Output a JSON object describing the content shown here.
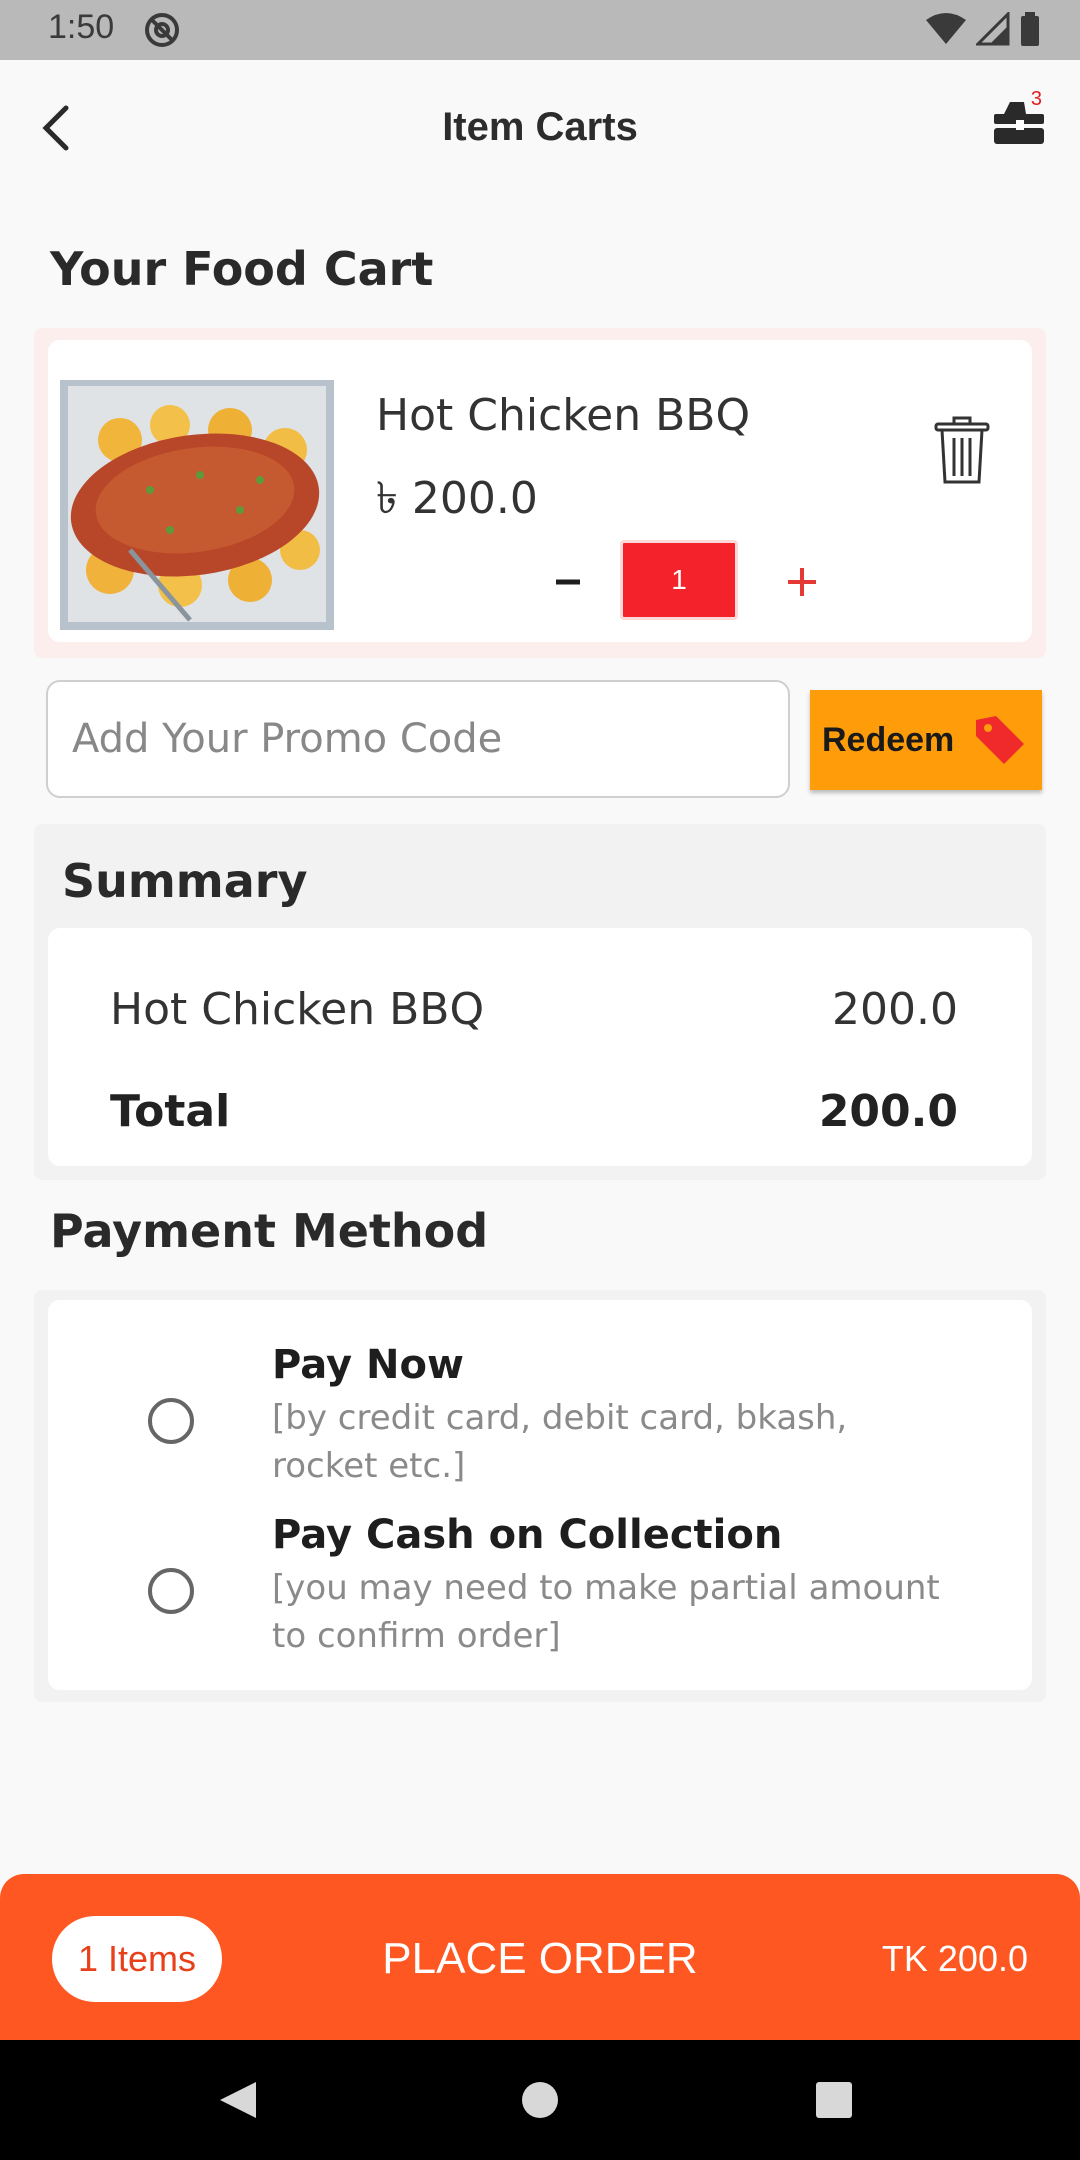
{
  "status_bar": {
    "time": "1:50"
  },
  "header": {
    "title": "Item Carts",
    "cart_count": "3"
  },
  "cart": {
    "title": "Your Food Cart",
    "items": [
      {
        "name": "Hot Chicken BBQ",
        "price": "৳ 200.0",
        "quantity": "1"
      }
    ]
  },
  "promo": {
    "placeholder": "Add Your Promo Code",
    "button_label": "Redeem"
  },
  "summary": {
    "title": "Summary",
    "rows": [
      {
        "name": "Hot Chicken BBQ",
        "value": "200.0"
      }
    ],
    "total_label": "Total",
    "total_value": "200.0"
  },
  "payment": {
    "title": "Payment Method",
    "options": [
      {
        "title": "Pay Now",
        "subtitle": "[by credit card, debit card, bkash, rocket etc.]"
      },
      {
        "title": "Pay Cash on Collection",
        "subtitle": "[you may need to make partial amount to confirm order]"
      }
    ]
  },
  "bottom_bar": {
    "items_label": "1 Items",
    "action_label": "PLACE ORDER",
    "total": "TK 200.0"
  },
  "colors": {
    "accent": "#ff5722",
    "quantity": "#f4222a",
    "redeem": "#ff9c0a"
  },
  "icons": [
    "back-arrow-icon",
    "cart-icon",
    "trash-icon",
    "minus-icon",
    "plus-icon",
    "tag-icon",
    "nav-back-icon",
    "nav-home-icon",
    "nav-recents-icon"
  ]
}
